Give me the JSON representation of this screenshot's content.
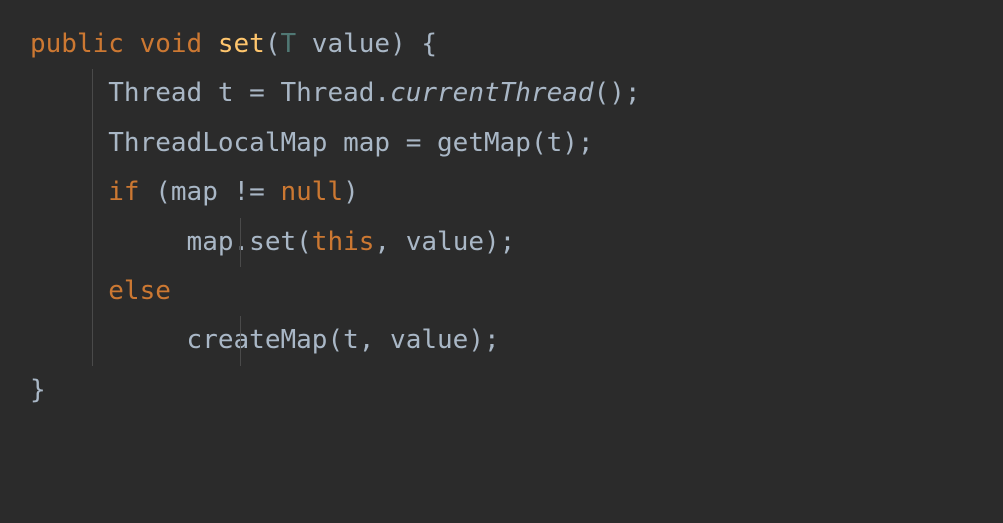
{
  "code": {
    "line1": {
      "public": "public",
      "void": "void",
      "method": "set",
      "lparen": "(",
      "type_param": "T",
      "param": " value",
      "rparen_brace": ") {"
    },
    "line2": {
      "indent": "     ",
      "type": "Thread",
      "var": " t ",
      "eq": "=",
      "type2": " Thread",
      "dot": ".",
      "method": "currentThread",
      "call": "();"
    },
    "line3": {
      "indent": "     ",
      "type": "ThreadLocalMap",
      "var": " map ",
      "eq": "=",
      "method": " getMap",
      "args": "(t);"
    },
    "line4": {
      "indent": "     ",
      "if": "if",
      "cond_open": " (map != ",
      "null": "null",
      "cond_close": ")"
    },
    "line5": {
      "indent": "          ",
      "obj": "map",
      "dot": ".",
      "method": "set",
      "open": "(",
      "this": "this",
      "rest": ", value);"
    },
    "line6": {
      "indent": "     ",
      "else": "else"
    },
    "line7": {
      "indent": "          ",
      "method": "createMap",
      "args": "(t, value);"
    },
    "line8": {
      "brace": "}"
    }
  }
}
